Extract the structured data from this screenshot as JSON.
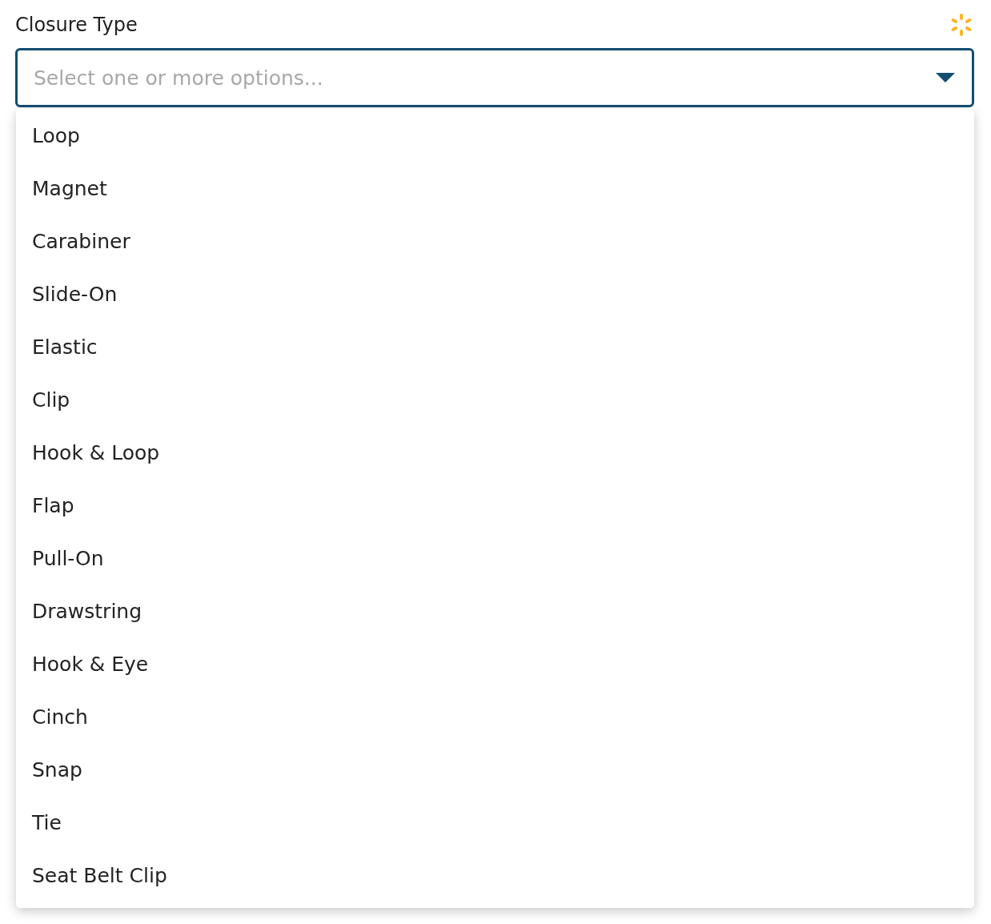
{
  "field": {
    "label": "Closure Type",
    "placeholder": "Select one or more options...",
    "expanded": true
  },
  "options": [
    {
      "label": "Loop",
      "selected": false
    },
    {
      "label": "Magnet",
      "selected": false
    },
    {
      "label": "Carabiner",
      "selected": false
    },
    {
      "label": "Slide-On",
      "selected": false
    },
    {
      "label": "Elastic",
      "selected": false
    },
    {
      "label": "Clip",
      "selected": false
    },
    {
      "label": "Hook & Loop",
      "selected": false
    },
    {
      "label": "Flap",
      "selected": false
    },
    {
      "label": "Pull-On",
      "selected": false
    },
    {
      "label": "Drawstring",
      "selected": false
    },
    {
      "label": "Hook & Eye",
      "selected": false
    },
    {
      "label": "Cinch",
      "selected": false
    },
    {
      "label": "Snap",
      "selected": false
    },
    {
      "label": "Tie",
      "selected": false
    },
    {
      "label": "Seat Belt Clip",
      "selected": false
    }
  ]
}
